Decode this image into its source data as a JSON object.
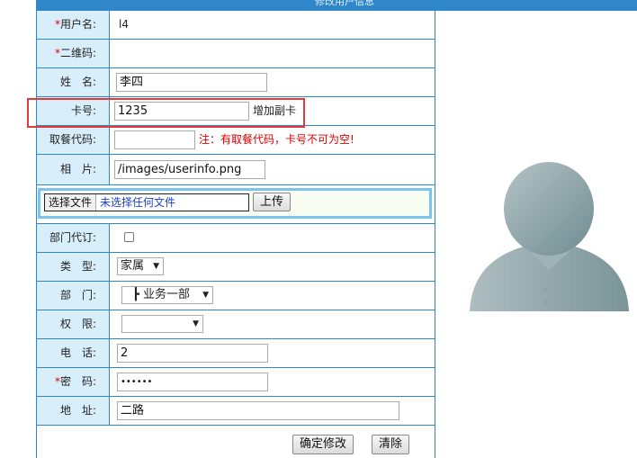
{
  "header": {
    "title": "修改用户信息"
  },
  "form": {
    "username": {
      "label": "用户名:",
      "value": "l4"
    },
    "qrcode": {
      "label": "二维码:"
    },
    "name": {
      "label": "姓　名:",
      "value": "李四"
    },
    "card": {
      "label": "卡号:",
      "value": "1235",
      "action": "增加副卡"
    },
    "meal_code": {
      "label": "取餐代码:",
      "value": "",
      "note": "注：有取餐代码，卡号不可为空!"
    },
    "photo": {
      "label": "相　片:",
      "value": "/images/userinfo.png"
    },
    "upload": {
      "choose_label": "选择文件",
      "no_file": "未选择任何文件",
      "upload_button": "上传"
    },
    "dept_order": {
      "label": "部门代订:",
      "checked": false
    },
    "type": {
      "label": "类　型:",
      "selected": "家属"
    },
    "department": {
      "label": "部　门:",
      "selected": "┣ 业务一部"
    },
    "permission": {
      "label": "权　限:",
      "selected": ""
    },
    "phone": {
      "label": "电　话:",
      "value": "2"
    },
    "password": {
      "label": "密　码:",
      "value": "••••••"
    },
    "address": {
      "label": "地　址:",
      "value": "二路"
    },
    "required_mark": "*"
  },
  "actions": {
    "confirm": "确定修改",
    "clear": "清除"
  },
  "colors": {
    "border": "#2f86c9",
    "label_bg": "#d8eefb",
    "required": "#e00000",
    "highlight": "#e03b3b"
  },
  "icons": {
    "avatar": "user-silhouette-icon"
  }
}
